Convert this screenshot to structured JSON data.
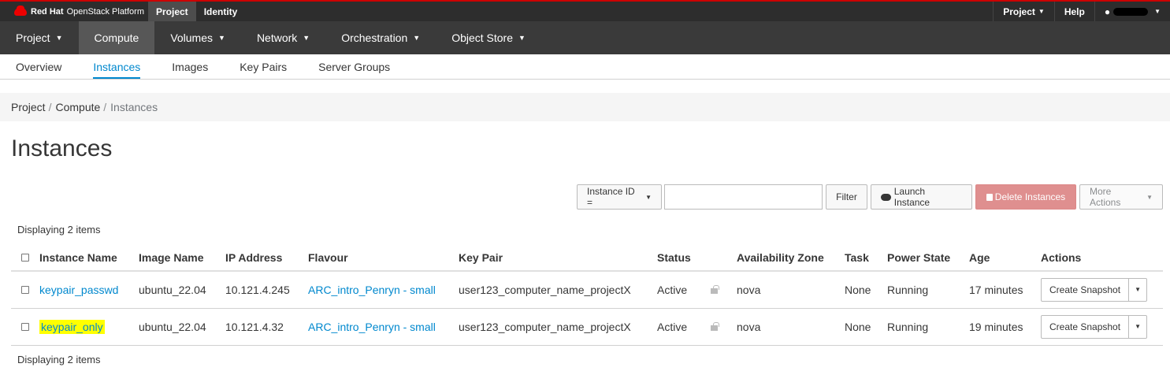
{
  "topbar": {
    "brand_bold": "Red Hat",
    "brand_rest": "OpenStack Platform",
    "nav": [
      "Project",
      "Identity"
    ],
    "right": {
      "project": "Project",
      "help": "Help"
    }
  },
  "secondbar": {
    "items": [
      {
        "label": "Project"
      },
      {
        "label": "Compute"
      },
      {
        "label": "Volumes"
      },
      {
        "label": "Network"
      },
      {
        "label": "Orchestration"
      },
      {
        "label": "Object Store"
      }
    ]
  },
  "thirdbar": {
    "items": [
      "Overview",
      "Instances",
      "Images",
      "Key Pairs",
      "Server Groups"
    ]
  },
  "breadcrumb": [
    "Project",
    "Compute",
    "Instances"
  ],
  "page_title": "Instances",
  "toolbar": {
    "filter_select": "Instance ID =",
    "filter_input_value": "",
    "filter_button": "Filter",
    "launch_button": "Launch Instance",
    "delete_button": "Delete Instances",
    "more_actions": "More Actions"
  },
  "count_text": "Displaying 2 items",
  "table": {
    "headers": [
      "Instance Name",
      "Image Name",
      "IP Address",
      "Flavour",
      "Key Pair",
      "Status",
      "Availability Zone",
      "Task",
      "Power State",
      "Age",
      "Actions"
    ],
    "rows": [
      {
        "name": "keypair_passwd",
        "image": "ubuntu_22.04",
        "ip": "10.121.4.245",
        "flavour": "ARC_intro_Penryn - small",
        "keypair": "user123_computer_name_projectX",
        "status": "Active",
        "zone": "nova",
        "task": "None",
        "power": "Running",
        "age": "17 minutes",
        "action": "Create Snapshot"
      },
      {
        "name": "keypair_only",
        "image": "ubuntu_22.04",
        "ip": "10.121.4.32",
        "flavour": "ARC_intro_Penryn - small",
        "keypair": "user123_computer_name_projectX",
        "status": "Active",
        "zone": "nova",
        "task": "None",
        "power": "Running",
        "age": "19 minutes",
        "action": "Create Snapshot"
      }
    ]
  },
  "colors": {
    "link": "#0088ce",
    "highlight": "#ffff00",
    "danger": "#df8f8f",
    "topbar": "#2d2d2d"
  }
}
